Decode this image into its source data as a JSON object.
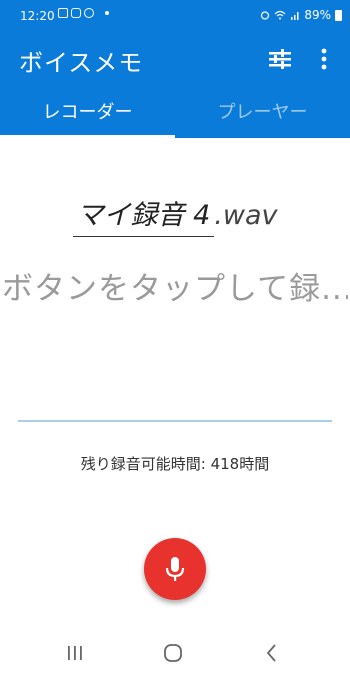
{
  "status_bar": {
    "time": "12:20",
    "battery": "89%"
  },
  "app_bar": {
    "title": "ボイスメモ",
    "tabs": [
      {
        "label": "レコーダー",
        "selected": true
      },
      {
        "label": "プレーヤー",
        "selected": false
      }
    ],
    "color": "#0a7bd8"
  },
  "recorder": {
    "filename_stem": "マイ録音 4",
    "filename_ext": ".wav",
    "hint": "ボタンをタップして録...",
    "remaining": "残り録音可能時間: 418時間",
    "record_button_color": "#e8322d"
  },
  "icons": {
    "tune": "tune-icon",
    "more": "more-vert-icon",
    "mic": "mic-icon"
  }
}
